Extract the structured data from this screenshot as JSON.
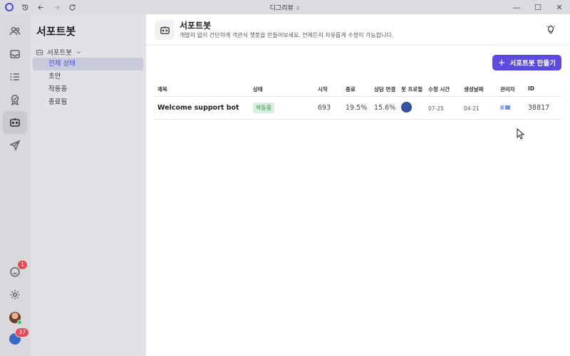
{
  "window": {
    "title": "디그리뷰",
    "title_chevron": "⇳"
  },
  "rail": {
    "notifications_badge": "1",
    "workspace_badge": "37"
  },
  "sidebar": {
    "heading": "서포트봇",
    "group_label": "서포트봇",
    "items": [
      {
        "label": "전체 상태",
        "active": true
      },
      {
        "label": "초안"
      },
      {
        "label": "작동중"
      },
      {
        "label": "종료됨"
      }
    ]
  },
  "header": {
    "title": "서포트봇",
    "subtitle": "개발자 없이 간단하게 객관식 챗봇을 만들어보세요. 언제든지 자유롭게 수정이 가능합니다."
  },
  "toolbar": {
    "create_label": "서포트봇 만들기"
  },
  "table": {
    "columns": [
      "제목",
      "상태",
      "시작",
      "종료",
      "상담 연결",
      "봇 프로필",
      "수정 시간",
      "생성날짜",
      "관리자",
      "ID"
    ],
    "rows": [
      {
        "title": "Welcome support bot",
        "status": "작동중",
        "start": "693",
        "end": "19.5%",
        "consult": "15.6%",
        "modified": "07-25",
        "created": "04-21",
        "id": "38817"
      }
    ]
  },
  "colors": {
    "accent": "#5b4be0",
    "status_active_bg": "#d8f0de",
    "status_active_text": "#2e8a47",
    "badge": "#e24a57"
  }
}
